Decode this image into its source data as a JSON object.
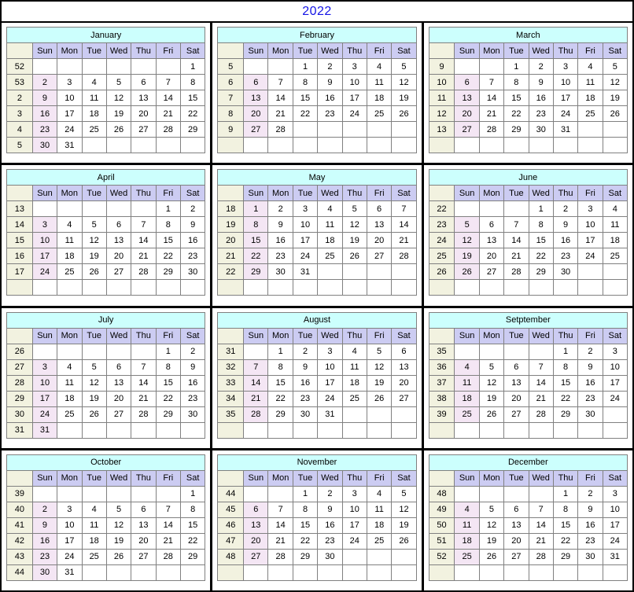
{
  "title": "2022",
  "colors": {
    "title_text": "#1414e6",
    "month_header_bg": "#ccfffd",
    "weekday_header_bg": "#ccccf2",
    "week_number_bg": "#f2f2e0",
    "week_number_text": "#1a1aff",
    "sunday_bg": "#f4e6f4",
    "sunday_text": "#ff0000",
    "day_text": "#000000",
    "border": "#000000"
  },
  "weekday_headers": [
    "Sun",
    "Mon",
    "Tue",
    "Wed",
    "Thu",
    "Fri",
    "Sat"
  ],
  "week_column_header": "",
  "months": [
    {
      "name": "January",
      "weeks": [
        {
          "week": "52",
          "days": [
            "",
            "",
            "",
            "",
            "",
            "",
            "1"
          ]
        },
        {
          "week": "53",
          "days": [
            "2",
            "3",
            "4",
            "5",
            "6",
            "7",
            "8"
          ]
        },
        {
          "week": "2",
          "days": [
            "9",
            "10",
            "11",
            "12",
            "13",
            "14",
            "15"
          ]
        },
        {
          "week": "3",
          "days": [
            "16",
            "17",
            "18",
            "19",
            "20",
            "21",
            "22"
          ]
        },
        {
          "week": "4",
          "days": [
            "23",
            "24",
            "25",
            "26",
            "27",
            "28",
            "29"
          ]
        },
        {
          "week": "5",
          "days": [
            "30",
            "31",
            "",
            "",
            "",
            "",
            ""
          ]
        }
      ]
    },
    {
      "name": "February",
      "weeks": [
        {
          "week": "5",
          "days": [
            "",
            "",
            "1",
            "2",
            "3",
            "4",
            "5"
          ]
        },
        {
          "week": "6",
          "days": [
            "6",
            "7",
            "8",
            "9",
            "10",
            "11",
            "12"
          ]
        },
        {
          "week": "7",
          "days": [
            "13",
            "14",
            "15",
            "16",
            "17",
            "18",
            "19"
          ]
        },
        {
          "week": "8",
          "days": [
            "20",
            "21",
            "22",
            "23",
            "24",
            "25",
            "26"
          ]
        },
        {
          "week": "9",
          "days": [
            "27",
            "28",
            "",
            "",
            "",
            "",
            ""
          ]
        },
        {
          "week": "",
          "days": [
            "",
            "",
            "",
            "",
            "",
            "",
            ""
          ]
        }
      ]
    },
    {
      "name": "March",
      "weeks": [
        {
          "week": "9",
          "days": [
            "",
            "",
            "1",
            "2",
            "3",
            "4",
            "5"
          ]
        },
        {
          "week": "10",
          "days": [
            "6",
            "7",
            "8",
            "9",
            "10",
            "11",
            "12"
          ]
        },
        {
          "week": "11",
          "days": [
            "13",
            "14",
            "15",
            "16",
            "17",
            "18",
            "19"
          ]
        },
        {
          "week": "12",
          "days": [
            "20",
            "21",
            "22",
            "23",
            "24",
            "25",
            "26"
          ]
        },
        {
          "week": "13",
          "days": [
            "27",
            "28",
            "29",
            "30",
            "31",
            "",
            ""
          ]
        },
        {
          "week": "",
          "days": [
            "",
            "",
            "",
            "",
            "",
            "",
            ""
          ]
        }
      ]
    },
    {
      "name": "April",
      "weeks": [
        {
          "week": "13",
          "days": [
            "",
            "",
            "",
            "",
            "",
            "1",
            "2"
          ]
        },
        {
          "week": "14",
          "days": [
            "3",
            "4",
            "5",
            "6",
            "7",
            "8",
            "9"
          ]
        },
        {
          "week": "15",
          "days": [
            "10",
            "11",
            "12",
            "13",
            "14",
            "15",
            "16"
          ]
        },
        {
          "week": "16",
          "days": [
            "17",
            "18",
            "19",
            "20",
            "21",
            "22",
            "23"
          ]
        },
        {
          "week": "17",
          "days": [
            "24",
            "25",
            "26",
            "27",
            "28",
            "29",
            "30"
          ]
        },
        {
          "week": "",
          "days": [
            "",
            "",
            "",
            "",
            "",
            "",
            ""
          ]
        }
      ]
    },
    {
      "name": "May",
      "weeks": [
        {
          "week": "18",
          "days": [
            "1",
            "2",
            "3",
            "4",
            "5",
            "6",
            "7"
          ]
        },
        {
          "week": "19",
          "days": [
            "8",
            "9",
            "10",
            "11",
            "12",
            "13",
            "14"
          ]
        },
        {
          "week": "20",
          "days": [
            "15",
            "16",
            "17",
            "18",
            "19",
            "20",
            "21"
          ]
        },
        {
          "week": "21",
          "days": [
            "22",
            "23",
            "24",
            "25",
            "26",
            "27",
            "28"
          ]
        },
        {
          "week": "22",
          "days": [
            "29",
            "30",
            "31",
            "",
            "",
            "",
            ""
          ]
        },
        {
          "week": "",
          "days": [
            "",
            "",
            "",
            "",
            "",
            "",
            ""
          ]
        }
      ]
    },
    {
      "name": "June",
      "weeks": [
        {
          "week": "22",
          "days": [
            "",
            "",
            "",
            "1",
            "2",
            "3",
            "4"
          ]
        },
        {
          "week": "23",
          "days": [
            "5",
            "6",
            "7",
            "8",
            "9",
            "10",
            "11"
          ]
        },
        {
          "week": "24",
          "days": [
            "12",
            "13",
            "14",
            "15",
            "16",
            "17",
            "18"
          ]
        },
        {
          "week": "25",
          "days": [
            "19",
            "20",
            "21",
            "22",
            "23",
            "24",
            "25"
          ]
        },
        {
          "week": "26",
          "days": [
            "26",
            "27",
            "28",
            "29",
            "30",
            "",
            ""
          ]
        },
        {
          "week": "",
          "days": [
            "",
            "",
            "",
            "",
            "",
            "",
            ""
          ]
        }
      ]
    },
    {
      "name": "July",
      "weeks": [
        {
          "week": "26",
          "days": [
            "",
            "",
            "",
            "",
            "",
            "1",
            "2"
          ]
        },
        {
          "week": "27",
          "days": [
            "3",
            "4",
            "5",
            "6",
            "7",
            "8",
            "9"
          ]
        },
        {
          "week": "28",
          "days": [
            "10",
            "11",
            "12",
            "13",
            "14",
            "15",
            "16"
          ]
        },
        {
          "week": "29",
          "days": [
            "17",
            "18",
            "19",
            "20",
            "21",
            "22",
            "23"
          ]
        },
        {
          "week": "30",
          "days": [
            "24",
            "25",
            "26",
            "27",
            "28",
            "29",
            "30"
          ]
        },
        {
          "week": "31",
          "days": [
            "31",
            "",
            "",
            "",
            "",
            "",
            ""
          ]
        }
      ]
    },
    {
      "name": "August",
      "weeks": [
        {
          "week": "31",
          "days": [
            "",
            "1",
            "2",
            "3",
            "4",
            "5",
            "6"
          ]
        },
        {
          "week": "32",
          "days": [
            "7",
            "8",
            "9",
            "10",
            "11",
            "12",
            "13"
          ]
        },
        {
          "week": "33",
          "days": [
            "14",
            "15",
            "16",
            "17",
            "18",
            "19",
            "20"
          ]
        },
        {
          "week": "34",
          "days": [
            "21",
            "22",
            "23",
            "24",
            "25",
            "26",
            "27"
          ]
        },
        {
          "week": "35",
          "days": [
            "28",
            "29",
            "30",
            "31",
            "",
            "",
            ""
          ]
        },
        {
          "week": "",
          "days": [
            "",
            "",
            "",
            "",
            "",
            "",
            ""
          ]
        }
      ]
    },
    {
      "name": "Setptember",
      "weeks": [
        {
          "week": "35",
          "days": [
            "",
            "",
            "",
            "",
            "1",
            "2",
            "3"
          ]
        },
        {
          "week": "36",
          "days": [
            "4",
            "5",
            "6",
            "7",
            "8",
            "9",
            "10"
          ]
        },
        {
          "week": "37",
          "days": [
            "11",
            "12",
            "13",
            "14",
            "15",
            "16",
            "17"
          ]
        },
        {
          "week": "38",
          "days": [
            "18",
            "19",
            "20",
            "21",
            "22",
            "23",
            "24"
          ]
        },
        {
          "week": "39",
          "days": [
            "25",
            "26",
            "27",
            "28",
            "29",
            "30",
            ""
          ]
        },
        {
          "week": "",
          "days": [
            "",
            "",
            "",
            "",
            "",
            "",
            ""
          ]
        }
      ]
    },
    {
      "name": "October",
      "weeks": [
        {
          "week": "39",
          "days": [
            "",
            "",
            "",
            "",
            "",
            "",
            "1"
          ]
        },
        {
          "week": "40",
          "days": [
            "2",
            "3",
            "4",
            "5",
            "6",
            "7",
            "8"
          ]
        },
        {
          "week": "41",
          "days": [
            "9",
            "10",
            "11",
            "12",
            "13",
            "14",
            "15"
          ]
        },
        {
          "week": "42",
          "days": [
            "16",
            "17",
            "18",
            "19",
            "20",
            "21",
            "22"
          ]
        },
        {
          "week": "43",
          "days": [
            "23",
            "24",
            "25",
            "26",
            "27",
            "28",
            "29"
          ]
        },
        {
          "week": "44",
          "days": [
            "30",
            "31",
            "",
            "",
            "",
            "",
            ""
          ]
        }
      ]
    },
    {
      "name": "November",
      "weeks": [
        {
          "week": "44",
          "days": [
            "",
            "",
            "1",
            "2",
            "3",
            "4",
            "5"
          ]
        },
        {
          "week": "45",
          "days": [
            "6",
            "7",
            "8",
            "9",
            "10",
            "11",
            "12"
          ]
        },
        {
          "week": "46",
          "days": [
            "13",
            "14",
            "15",
            "16",
            "17",
            "18",
            "19"
          ]
        },
        {
          "week": "47",
          "days": [
            "20",
            "21",
            "22",
            "23",
            "24",
            "25",
            "26"
          ]
        },
        {
          "week": "48",
          "days": [
            "27",
            "28",
            "29",
            "30",
            "",
            "",
            ""
          ]
        },
        {
          "week": "",
          "days": [
            "",
            "",
            "",
            "",
            "",
            "",
            ""
          ]
        }
      ]
    },
    {
      "name": "December",
      "weeks": [
        {
          "week": "48",
          "days": [
            "",
            "",
            "",
            "",
            "1",
            "2",
            "3"
          ]
        },
        {
          "week": "49",
          "days": [
            "4",
            "5",
            "6",
            "7",
            "8",
            "9",
            "10"
          ]
        },
        {
          "week": "50",
          "days": [
            "11",
            "12",
            "13",
            "14",
            "15",
            "16",
            "17"
          ]
        },
        {
          "week": "51",
          "days": [
            "18",
            "19",
            "20",
            "21",
            "22",
            "23",
            "24"
          ]
        },
        {
          "week": "52",
          "days": [
            "25",
            "26",
            "27",
            "28",
            "29",
            "30",
            "31"
          ]
        },
        {
          "week": "",
          "days": [
            "",
            "",
            "",
            "",
            "",
            "",
            ""
          ]
        }
      ]
    }
  ]
}
